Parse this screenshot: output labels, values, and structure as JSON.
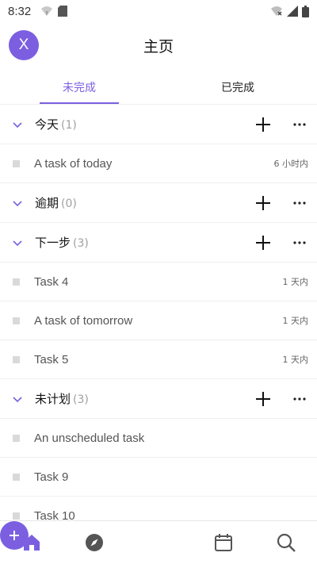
{
  "status_bar": {
    "time": "8:32"
  },
  "header": {
    "avatar_letter": "X",
    "title": "主页"
  },
  "tabs": [
    {
      "label": "未完成",
      "active": true
    },
    {
      "label": "已完成",
      "active": false
    }
  ],
  "groups": [
    {
      "title": "今天",
      "count": "(1)",
      "tasks": [
        {
          "title": "A task of today",
          "due": "6 小时内"
        }
      ]
    },
    {
      "title": "逾期",
      "count": "(0)",
      "tasks": []
    },
    {
      "title": "下一步",
      "count": "(3)",
      "tasks": [
        {
          "title": "Task 4",
          "due": "1 天内"
        },
        {
          "title": "A task of tomorrow",
          "due": "1 天内"
        },
        {
          "title": "Task 5",
          "due": "1 天内"
        }
      ]
    },
    {
      "title": "未计划",
      "count": "(3)",
      "tasks": [
        {
          "title": "An unscheduled task",
          "due": ""
        },
        {
          "title": "Task 9",
          "due": ""
        },
        {
          "title": "Task 10",
          "due": ""
        }
      ]
    }
  ],
  "icons": {
    "chevron": "chevron-down-icon",
    "add": "plus-icon",
    "more": "more-horizontal-icon",
    "nav": [
      "home-icon",
      "compass-icon",
      "plus-icon",
      "calendar-icon",
      "search-icon"
    ]
  },
  "colors": {
    "accent": "#7b5fe0",
    "muted": "#a0a0a0",
    "checkbox": "#d9d9d9"
  }
}
